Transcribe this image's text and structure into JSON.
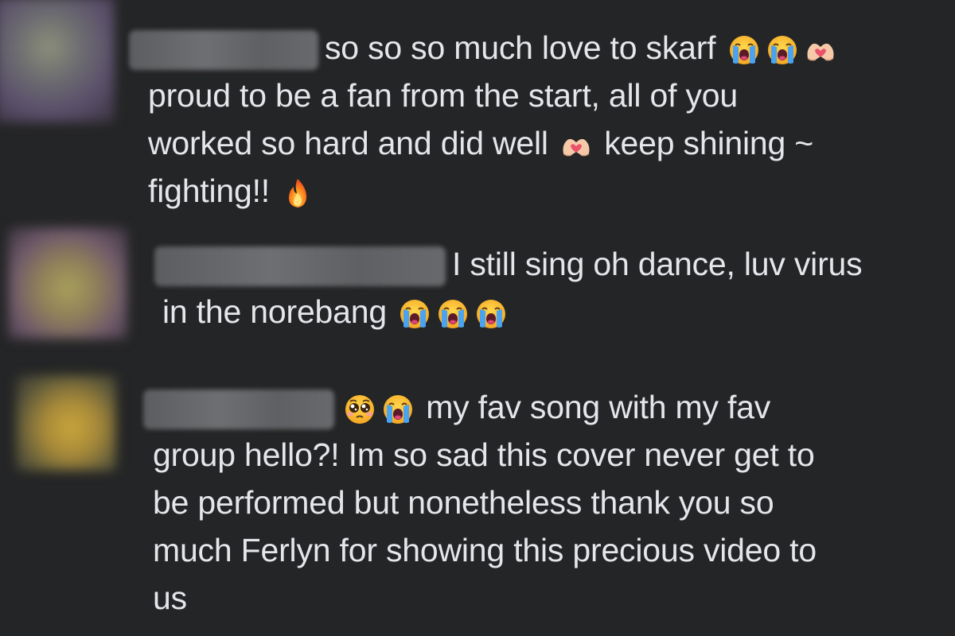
{
  "comments": [
    {
      "line1": "so so so much love to skarf",
      "line2": "proud to be a fan from the start, all of you",
      "line3a": "worked so hard and did well",
      "line3b": "keep shining ~",
      "line4": "fighting!!"
    },
    {
      "line1": "I still sing oh dance, luv virus",
      "line2": "in the norebang"
    },
    {
      "line1": "my fav song with my fav",
      "line2": "group hello?! Im so sad this cover never get to",
      "line3": "be performed but nonetheless thank you so",
      "line4": "much Ferlyn for showing this precious video to",
      "line5": "us"
    }
  ],
  "icons": {
    "crying": "loudly-crying-face-icon",
    "heart_hands": "heart-hands-icon",
    "fire": "fire-icon",
    "pleading": "pleading-face-icon"
  },
  "colors": {
    "background": "#242526",
    "text": "#e4e6eb"
  }
}
